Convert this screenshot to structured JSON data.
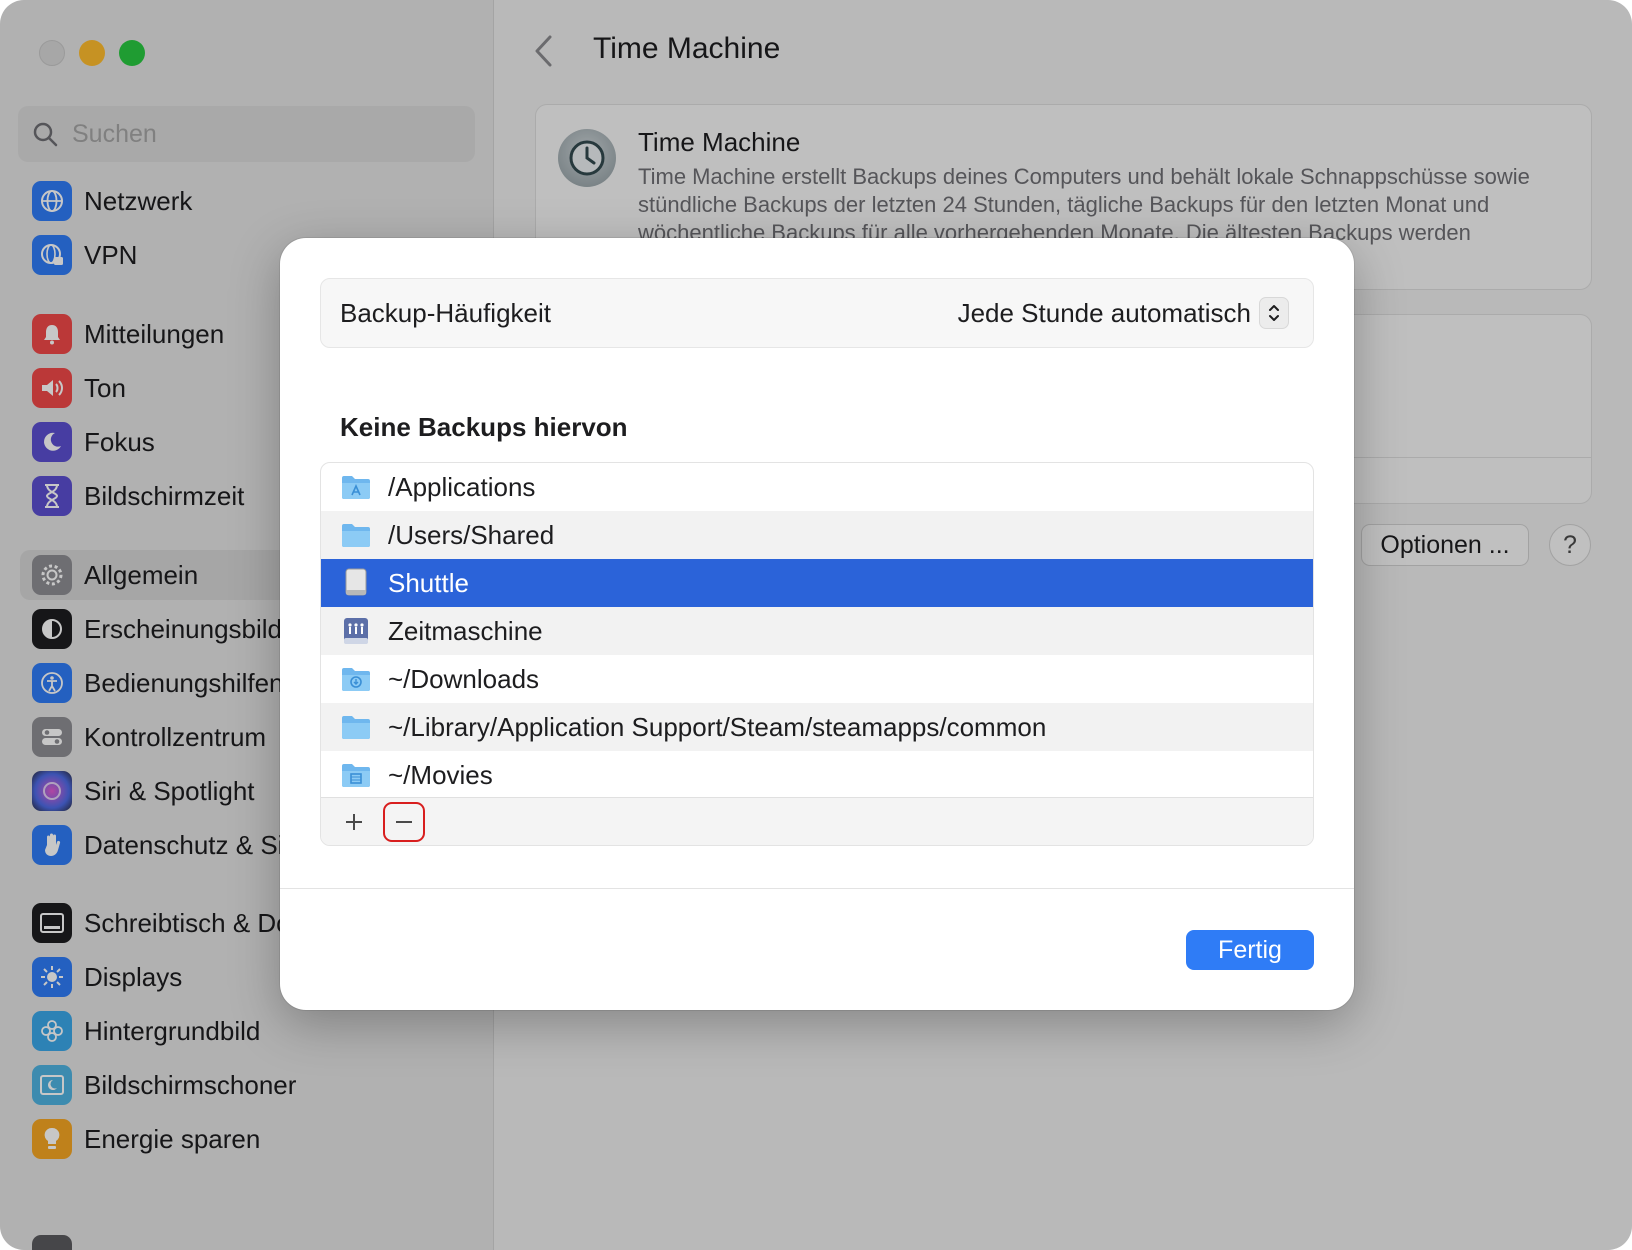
{
  "sidebar": {
    "search_placeholder": "Suchen",
    "items": [
      {
        "label": "Netzwerk",
        "icon": "globe-icon",
        "color": "#2f7cf6"
      },
      {
        "label": "VPN",
        "icon": "globe-lock-icon",
        "color": "#2f7cf6"
      },
      {
        "label": "Mitteilungen",
        "icon": "bell-icon",
        "color": "#f04848"
      },
      {
        "label": "Ton",
        "icon": "speaker-icon",
        "color": "#f04848"
      },
      {
        "label": "Fokus",
        "icon": "moon-icon",
        "color": "#5b4fd0"
      },
      {
        "label": "Bildschirmzeit",
        "icon": "hourglass-icon",
        "color": "#5b4fd0"
      },
      {
        "label": "Allgemein",
        "icon": "gear-icon",
        "color": "#8e8e93"
      },
      {
        "label": "Erscheinungsbild",
        "icon": "appearance-icon",
        "color": "#1d1d1f"
      },
      {
        "label": "Bedienungshilfen",
        "icon": "accessibility-icon",
        "color": "#2f7cf6"
      },
      {
        "label": "Kontrollzentrum",
        "icon": "toggles-icon",
        "color": "#8e8e93"
      },
      {
        "label": "Siri & Spotlight",
        "icon": "siri-icon",
        "color": "#7b4fd0"
      },
      {
        "label": "Datenschutz & Sicherheit",
        "icon": "hand-icon",
        "color": "#2f7cf6"
      },
      {
        "label": "Schreibtisch & Dock",
        "icon": "dock-icon",
        "color": "#1d1d1f"
      },
      {
        "label": "Displays",
        "icon": "sun-icon",
        "color": "#2f7cf6"
      },
      {
        "label": "Hintergrundbild",
        "icon": "flower-icon",
        "color": "#3aa7e8"
      },
      {
        "label": "Bildschirmschoner",
        "icon": "screensaver-icon",
        "color": "#4fb3e0"
      },
      {
        "label": "Energie sparen",
        "icon": "bulb-icon",
        "color": "#f5a623"
      }
    ]
  },
  "content": {
    "title": "Time Machine",
    "card_title": "Time Machine",
    "card_description": "Time Machine erstellt Backups deines Computers und behält lokale Schnappschüsse sowie stündliche Backups der letzten 24 Stunden, tägliche Backups für den letzten Monat und wöchentliche Backups für alle vorhergehenden Monate. Die ältesten Backups werden gelöscht, wenn Speicherplatz benötigt wird.",
    "options_button": "Optionen ...",
    "help_button": "?"
  },
  "sheet": {
    "frequency_label": "Backup-Häufigkeit",
    "frequency_value": "Jede Stunde automatisch",
    "exclusions_heading": "Keine Backups hiervon",
    "exclusions": [
      {
        "path": "/Applications",
        "icon": "applications-folder-icon",
        "selected": false
      },
      {
        "path": "/Users/Shared",
        "icon": "folder-icon",
        "selected": false
      },
      {
        "path": "Shuttle",
        "icon": "external-drive-icon",
        "selected": true
      },
      {
        "path": "Zeitmaschine",
        "icon": "network-drive-icon",
        "selected": false
      },
      {
        "path": "~/Downloads",
        "icon": "downloads-folder-icon",
        "selected": false
      },
      {
        "path": "~/Library/Application Support/Steam/steamapps/common",
        "icon": "folder-icon",
        "selected": false
      },
      {
        "path": "~/Movies",
        "icon": "movies-folder-icon",
        "selected": false
      }
    ],
    "add_button": "+",
    "remove_button": "−",
    "done_button": "Fertig"
  },
  "colors": {
    "accent": "#2f7cf6",
    "selection": "#2b63d9",
    "highlight_outline": "#d81e1e"
  }
}
